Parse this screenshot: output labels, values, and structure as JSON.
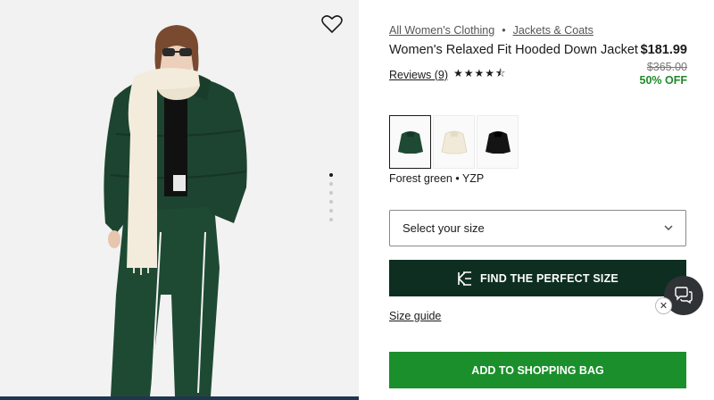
{
  "breadcrumb": {
    "items": [
      "All Women's Clothing",
      "Jackets & Coats"
    ],
    "separator": "•"
  },
  "product": {
    "title": "Women's Relaxed Fit Hooded Down Jacket",
    "price": "$181.99",
    "original_price": "$365.00",
    "discount": "50% OFF",
    "reviews_label": "Reviews (9)",
    "rating": 4.5,
    "stars_text": "★★★★⯪"
  },
  "swatches": {
    "items": [
      {
        "name": "Forest green",
        "color": "#1e4a33",
        "selected": true
      },
      {
        "name": "cream",
        "color": "#f1ead9",
        "selected": false
      },
      {
        "name": "black",
        "color": "#141414",
        "selected": false
      }
    ],
    "selected_label": "Forest green • YZP"
  },
  "size_select": {
    "placeholder": "Select your size"
  },
  "buttons": {
    "find_size": "FIND THE PERFECT SIZE",
    "size_guide": "Size guide",
    "add_to_bag": "ADD TO SHOPPING BAG"
  },
  "gallery": {
    "total_images": 6,
    "active_index": 0
  },
  "colors": {
    "dark_green_button": "#0e2e22",
    "add_to_bag_green": "#1b8f2b",
    "discount_green": "#1f8a2a",
    "jacket_green": "#1e4a33"
  }
}
